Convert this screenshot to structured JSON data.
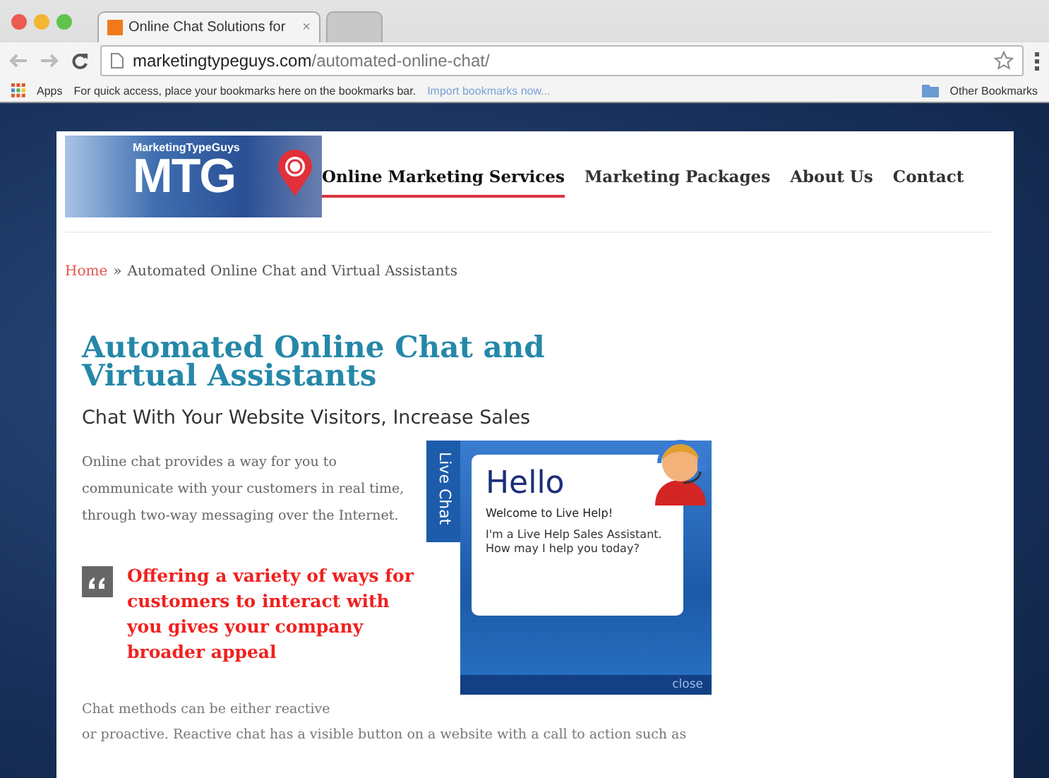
{
  "browser": {
    "tabs": [
      {
        "title": "Online Chat Solutions for",
        "close": "×",
        "selected": true
      },
      {
        "selected": false
      }
    ],
    "url_domain": "marketingtypeguys.com",
    "url_path": "/automated-online-chat/",
    "bookmarks_bar": {
      "apps": "Apps",
      "hint": "For quick access, place your bookmarks here on the bookmarks bar.",
      "import_link": "Import bookmarks now...",
      "other": "Other Bookmarks"
    }
  },
  "logo": {
    "top_text": "MarketingTypeGuys",
    "letters": "MTG"
  },
  "nav": [
    {
      "label": "Online Marketing Services",
      "selected": true
    },
    {
      "label": "Marketing Packages",
      "selected": false
    },
    {
      "label": "About Us",
      "selected": false
    },
    {
      "label": "Contact",
      "selected": false
    }
  ],
  "breadcrumb": {
    "home": "Home",
    "separator": "»",
    "current": "Automated Online Chat and Virtual Assistants"
  },
  "title": "Automated Online Chat and Virtual Assistants",
  "subtitle": "Chat With Your Website Visitors, Increase Sales",
  "intro": "Online chat provides a way for you to communicate with your customers in real time, through two-way messaging over the Internet.",
  "quote": "Offering a variety of ways for customers to interact with you gives your company broader appeal",
  "chat_widget": {
    "tab": "Live Chat",
    "greeting": "Hello",
    "welcome": "Welcome to Live Help!",
    "message": "I'm a Live Help Sales Assistant. How may I help you today?",
    "close": "close"
  },
  "body_1": "Chat methods can be either reactive",
  "body_2": "or proactive. Reactive chat has a visible button on a website with a call to action such as"
}
